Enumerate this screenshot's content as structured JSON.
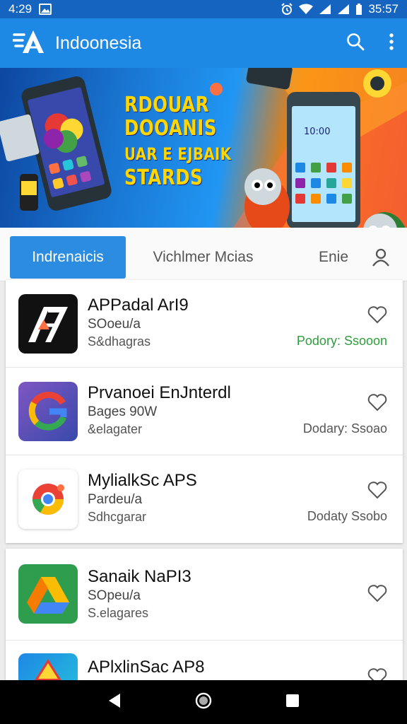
{
  "status_bar": {
    "time": "4:29",
    "clock_right": "35:57"
  },
  "app_bar": {
    "title": "Indoonesia"
  },
  "banner": {
    "line1": "RDOUAR",
    "line2": "DOOANIS",
    "line3": "UAR E EJBAIK",
    "line4": "STARDS",
    "phone_clock": "10:00"
  },
  "tabs": [
    {
      "label": "Indrenaicis"
    },
    {
      "label": "Vichlmer Mcias"
    },
    {
      "label": "Enie"
    }
  ],
  "apps": [
    {
      "title": "APPadal ArI9",
      "sub1": "SOoeu/a",
      "sub2": "S&dhagras",
      "status": "Podory: Ssooon",
      "status_color": "#2e9e3a"
    },
    {
      "title": "Prvanoei EnJnterdl",
      "sub1": "Bages 90W",
      "sub2": "&elagater",
      "status": "Dodary: Ssoao",
      "status_color": "#555555"
    },
    {
      "title": "MylialkSc APS",
      "sub1": "Pardeu/a",
      "sub2": "Sdhcgarar",
      "status": "Dodaty Ssobo",
      "status_color": "#555555"
    },
    {
      "title": "Sanaik NaPI3",
      "sub1": "SOpeu/a",
      "sub2": "S.elagares",
      "status": "",
      "status_color": "#555555"
    },
    {
      "title": "APlxlinSac AP8",
      "sub1": "",
      "sub2": "",
      "status": "",
      "status_color": "#555555"
    }
  ],
  "colors": {
    "primary": "#1e88e5",
    "status_bar": "#1565c0",
    "tab_active": "#2b8ce0",
    "green": "#2e9e3a"
  }
}
